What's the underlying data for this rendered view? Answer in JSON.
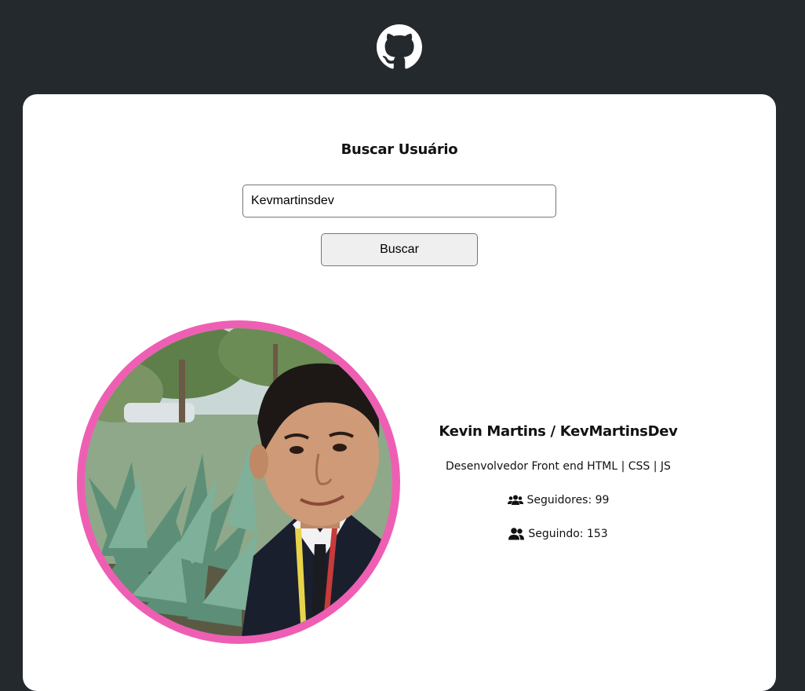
{
  "header": {
    "logo_icon": "github-icon"
  },
  "search": {
    "title": "Buscar Usuário",
    "input_value": "Kevmartinsdev",
    "button_label": "Buscar"
  },
  "profile": {
    "avatar_ring_color": "#ee5fb4",
    "name": "Kevin Martins / KevMartinsDev",
    "bio": "Desenvolvedor Front end HTML | CSS | JS",
    "followers_icon": "users-icon",
    "followers_text": "Seguidores: 99",
    "following_icon": "user-friends-icon",
    "following_text": "Seguindo: 153"
  }
}
